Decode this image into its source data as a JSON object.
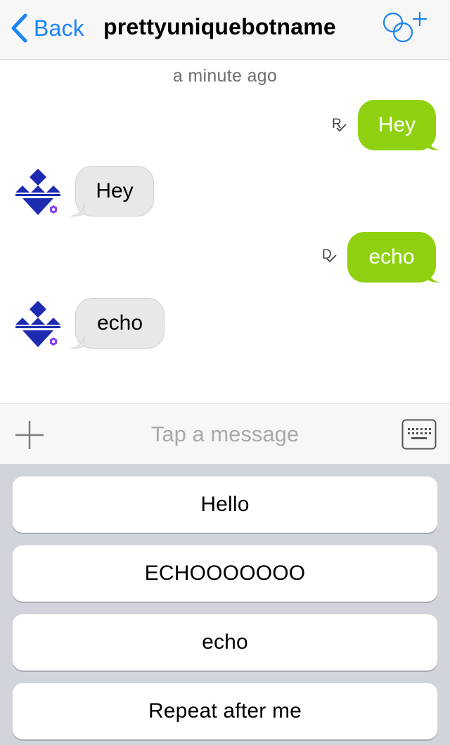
{
  "header": {
    "back_label": "Back",
    "title": "prettyuniquebotname",
    "accent_color": "#1a84f5"
  },
  "conversation": {
    "timestamp": "a minute ago",
    "messages": [
      {
        "direction": "outgoing",
        "text": "Hey",
        "receipt": "R",
        "receipt_icon": "check-icon"
      },
      {
        "direction": "incoming",
        "text": "Hey",
        "avatar": "bot-avatar"
      },
      {
        "direction": "outgoing",
        "text": "echo",
        "receipt": "D",
        "receipt_icon": "check-icon"
      },
      {
        "direction": "incoming",
        "text": "echo",
        "avatar": "bot-avatar"
      }
    ],
    "outgoing_bubble_color": "#8fd110",
    "incoming_bubble_color": "#e7e8ea"
  },
  "composer": {
    "placeholder": "Tap a message",
    "value": ""
  },
  "quick_replies": {
    "items": [
      "Hello",
      "ECHOOOOOOO",
      "echo",
      "Repeat after me"
    ]
  },
  "icons": {
    "back": "chevron-left-icon",
    "add_people": "add-people-icon",
    "attach": "plus-icon",
    "keyboard": "keyboard-icon"
  }
}
